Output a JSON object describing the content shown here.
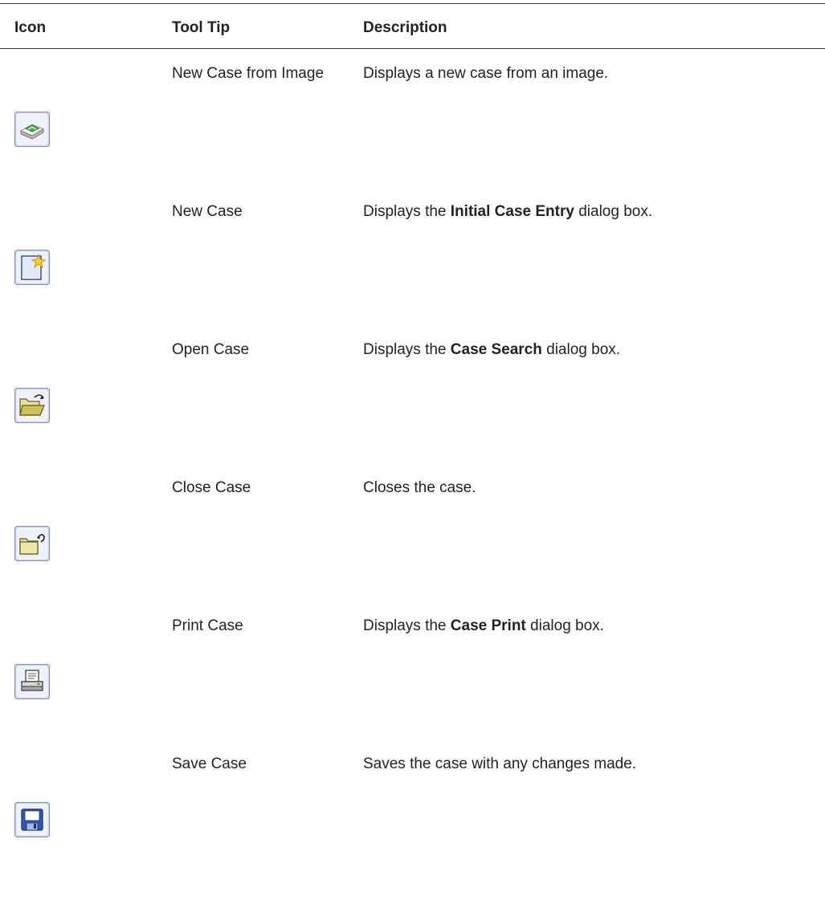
{
  "table": {
    "headers": {
      "icon": "Icon",
      "tooltip": "Tool Tip",
      "description": "Description"
    },
    "rows": [
      {
        "icon": "new-case-from-image-icon",
        "tooltip": "New Case from Image",
        "desc_before": "Displays a new case from an image.",
        "desc_bold": "",
        "desc_after": ""
      },
      {
        "icon": "new-case-icon",
        "tooltip": "New Case",
        "desc_before": "Displays the ",
        "desc_bold": "Initial Case Entry",
        "desc_after": " dialog box."
      },
      {
        "icon": "open-case-icon",
        "tooltip": "Open Case",
        "desc_before": "Displays the ",
        "desc_bold": "Case Search",
        "desc_after": " dialog box."
      },
      {
        "icon": "close-case-icon",
        "tooltip": "Close Case",
        "desc_before": "Closes the case.",
        "desc_bold": "",
        "desc_after": ""
      },
      {
        "icon": "print-case-icon",
        "tooltip": "Print Case",
        "desc_before": "Displays the ",
        "desc_bold": "Case Print",
        "desc_after": " dialog box."
      },
      {
        "icon": "save-case-icon",
        "tooltip": "Save Case",
        "desc_before": "Saves the case with any changes made.",
        "desc_bold": "",
        "desc_after": ""
      }
    ]
  }
}
